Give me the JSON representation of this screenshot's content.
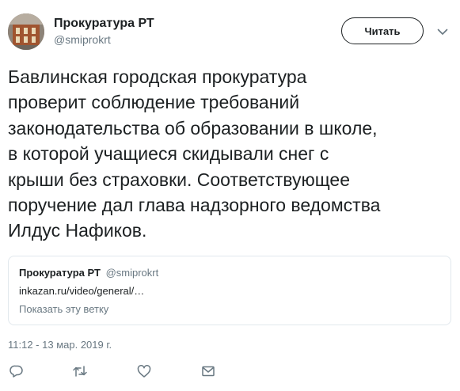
{
  "author": {
    "name": "Прокуратура РТ",
    "handle": "@smiprokrt"
  },
  "follow_button": {
    "label": "Читать"
  },
  "menu_icon": "chevron-down-icon",
  "tweet": {
    "text": "Бавлинская городская прокуратура\nпроверит соблюдение требований\nзаконодательства об образовании в школе,\nв которой учащиеся скидывали снег с\nкрыши без страховки. Соответствующее\nпоручение дал глава надзорного ведомства\nИлдус Нафиков."
  },
  "quote": {
    "name": "Прокуратура РТ",
    "handle": "@smiprokrt",
    "link": "inkazan.ru/video/general/…",
    "thread_label": "Показать эту ветку"
  },
  "timestamp": "11:12 - 13 мар. 2019 г.",
  "actions": [
    "reply-icon",
    "retweet-icon",
    "like-icon",
    "message-icon"
  ],
  "colors": {
    "text": "#1c2022",
    "secondary": "#697882",
    "border": "#e1e8ed"
  }
}
